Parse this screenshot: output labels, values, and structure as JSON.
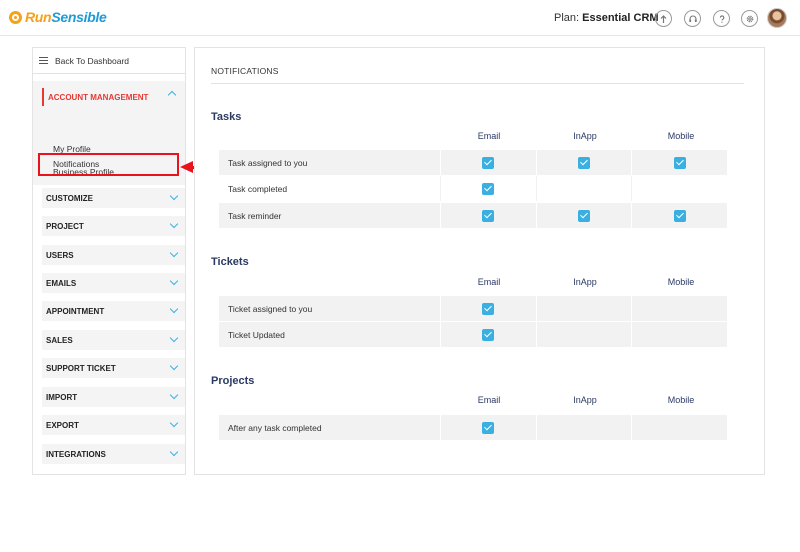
{
  "header": {
    "brand_part1": "Run",
    "brand_part2": "Sensible",
    "plan_label": "Plan:",
    "plan_name": "Essential CRM",
    "icons": [
      "upload-icon",
      "headset-icon",
      "help-icon",
      "gear-icon"
    ],
    "brand_colors": {
      "orange": "#f5a11a",
      "blue": "#1e9bd7"
    }
  },
  "sidebar": {
    "back_label": "Back To Dashboard",
    "account_section": {
      "title": "ACCOUNT MANAGEMENT",
      "items": [
        "My Profile",
        "Business Profile",
        "Notifications"
      ],
      "selected": "Notifications"
    },
    "sections": [
      "CUSTOMIZE",
      "PROJECT",
      "USERS",
      "EMAILS",
      "APPOINTMENT",
      "SALES",
      "SUPPORT TICKET",
      "IMPORT",
      "EXPORT",
      "INTEGRATIONS"
    ]
  },
  "main": {
    "title": "NOTIFICATIONS",
    "columns": [
      "Email",
      "InApp",
      "Mobile"
    ],
    "groups": [
      {
        "title": "Tasks",
        "rows": [
          {
            "label": "Task assigned to you",
            "email": true,
            "inapp": true,
            "mobile": true
          },
          {
            "label": "Task completed",
            "email": true,
            "inapp": false,
            "mobile": false
          },
          {
            "label": "Task reminder",
            "email": true,
            "inapp": true,
            "mobile": true
          }
        ]
      },
      {
        "title": "Tickets",
        "rows": [
          {
            "label": "Ticket assigned to you",
            "email": true,
            "inapp": false,
            "mobile": false
          },
          {
            "label": "Ticket Updated",
            "email": true,
            "inapp": false,
            "mobile": false
          }
        ]
      },
      {
        "title": "Projects",
        "rows": [
          {
            "label": "After any task completed",
            "email": true,
            "inapp": false,
            "mobile": false
          }
        ]
      }
    ],
    "accent_color": "#3ab0e2",
    "highlight_color": "#e8131b"
  }
}
